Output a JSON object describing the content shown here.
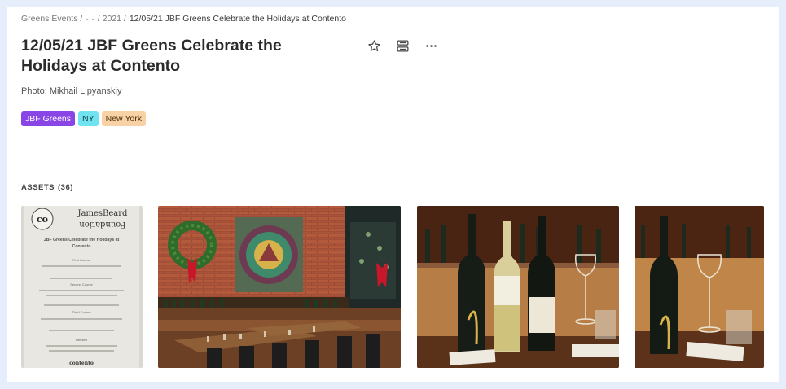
{
  "breadcrumb": {
    "root": "Greens Events /",
    "ellipsis": "···",
    "year": "/ 2021 /",
    "current": "12/05/21 JBF Greens Celebrate the Holidays at Contento"
  },
  "page": {
    "title": "12/05/21 JBF Greens Celebrate the Holidays at Contento",
    "caption": "Photo: Mikhail Lipyanskiy"
  },
  "tags": [
    {
      "label": "JBF Greens",
      "bg": "#8a45e6",
      "fg": "#ffffff"
    },
    {
      "label": "NY",
      "bg": "#6fe3f0",
      "fg": "#1b3a40"
    },
    {
      "label": "New York",
      "bg": "#f8d2a4",
      "fg": "#4a2e10"
    }
  ],
  "assets": {
    "label": "ASSETS",
    "count": "(36)"
  },
  "thumbnails": [
    {
      "name": "menu-card",
      "logo": "co",
      "brand_line1": "JamesBeard",
      "brand_line2": "Foundation",
      "menu_title_1": "JBF Greens Celebrate the Holidays at",
      "menu_title_2": "Contento",
      "courses": [
        "First Course",
        "Second Course",
        "Third Course",
        "Dessert"
      ],
      "footer": "contento"
    },
    {
      "name": "dining-room-wreath"
    },
    {
      "name": "wine-bottles-table"
    },
    {
      "name": "wine-bottle-glasses"
    }
  ],
  "icons": {
    "star": "star-icon",
    "layout": "layout-icon",
    "more": "more-horizontal-icon"
  }
}
